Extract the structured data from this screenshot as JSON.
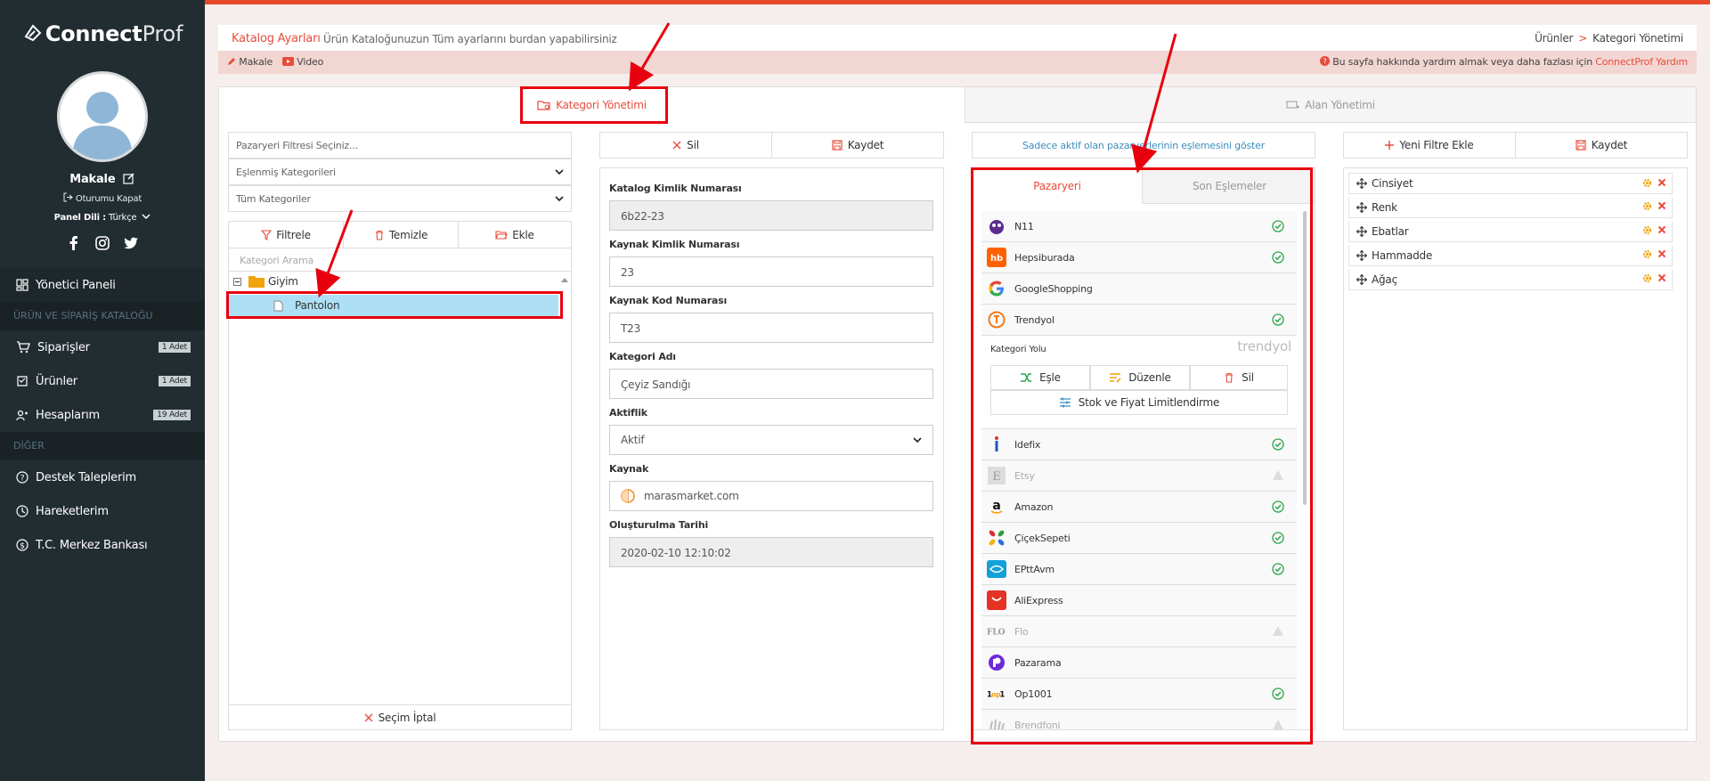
{
  "app": {
    "logo_bold": "Connect",
    "logo_light": "Prof"
  },
  "user": {
    "name": "Makale",
    "logout": "Oturumu Kapat",
    "lang_label": "Panel Dili :",
    "lang_value": "Türkçe"
  },
  "nav": {
    "dashboard": "Yönetici Paneli",
    "section1": "ÜRÜN VE SİPARİŞ KATALOĞU",
    "orders": {
      "label": "Siparişler",
      "badge": "1 Adet"
    },
    "products": {
      "label": "Ürünler",
      "badge": "1 Adet"
    },
    "accounts": {
      "label": "Hesaplarım",
      "badge": "19 Adet"
    },
    "section2": "DİĞER",
    "support": "Destek Taleplerim",
    "activity": "Hareketlerim",
    "bank": "T.C. Merkez Bankası"
  },
  "header": {
    "title": "Katalog Ayarları",
    "subtitle": "Ürün Kataloğunuzun Tüm ayarlarını burdan yapabilirsiniz",
    "bc1": "Ürünler",
    "bc_sep": ">",
    "bc2": "Kategori Yönetimi"
  },
  "subbar": {
    "article": "Makale",
    "video": "Video",
    "help_text": "Bu sayfa hakkında yardım almak veya daha fazlası için",
    "help_link": "ConnectProf Yardım"
  },
  "tabs": {
    "category": "Kategori Yönetimi",
    "field": "Alan Yönetimi"
  },
  "col1": {
    "filter_placeholder": "Pazaryeri Filtresi Seçiniz...",
    "select1": "Eşlenmiş Kategorileri",
    "select2": "Tüm Kategoriler",
    "btn_filter": "Filtrele",
    "btn_clear": "Temizle",
    "btn_add": "Ekle",
    "search_placeholder": "Kategori Arama",
    "tree_root": "Giyim",
    "tree_child": "Pantolon",
    "cancel": "Seçim İptal"
  },
  "col2": {
    "delete": "Sil",
    "save": "Kaydet",
    "f1_label": "Katalog Kimlik Numarası",
    "f1_value": "6b22-23",
    "f2_label": "Kaynak Kimlik Numarası",
    "f2_value": "23",
    "f3_label": "Kaynak Kod Numarası",
    "f3_value": "T23",
    "f4_label": "Kategori Adı",
    "f4_value": "Çeyiz Sandığı",
    "f5_label": "Aktiflik",
    "f5_value": "Aktif",
    "f6_label": "Kaynak",
    "f6_value": "marasmarket.com",
    "f7_label": "Oluşturulma Tarihi",
    "f7_value": "2020-02-10 12:10:02"
  },
  "col3": {
    "show_active": "Sadece aktif olan pazaryerlerinin eşlemesini göster",
    "tab_market": "Pazaryeri",
    "tab_recent": "Son Eşlemeler",
    "markets": [
      {
        "name": "N11",
        "status": "ok"
      },
      {
        "name": "Hepsiburada",
        "status": "ok"
      },
      {
        "name": "GoogleShopping",
        "status": ""
      },
      {
        "name": "Trendyol",
        "status": "ok"
      },
      {
        "name": "Idefix",
        "status": "ok"
      },
      {
        "name": "Etsy",
        "status": "warn"
      },
      {
        "name": "Amazon",
        "status": "ok"
      },
      {
        "name": "ÇiçekSepeti",
        "status": "ok"
      },
      {
        "name": "EPttAvm",
        "status": "ok"
      },
      {
        "name": "AliExpress",
        "status": ""
      },
      {
        "name": "Flo",
        "status": "warn"
      },
      {
        "name": "Pazarama",
        "status": ""
      },
      {
        "name": "Op1001",
        "status": "ok"
      },
      {
        "name": "Brendfoni",
        "status": "warn"
      }
    ],
    "trendyol_logo": "trendyol",
    "cat_path": "Kategori Yolu",
    "btn_match": "Eşle",
    "btn_edit": "Düzenle",
    "btn_del": "Sil",
    "btn_limit": "Stok ve Fiyat Limitlendirme"
  },
  "col4": {
    "new_filter": "Yeni Filtre Ekle",
    "save": "Kaydet",
    "filters": [
      "Cinsiyet",
      "Renk",
      "Ebatlar",
      "Hammadde",
      "Ağaç"
    ]
  },
  "colors": {
    "accent": "#e74c3c",
    "sidebar": "#222d32",
    "annotation": "#e8000e"
  }
}
